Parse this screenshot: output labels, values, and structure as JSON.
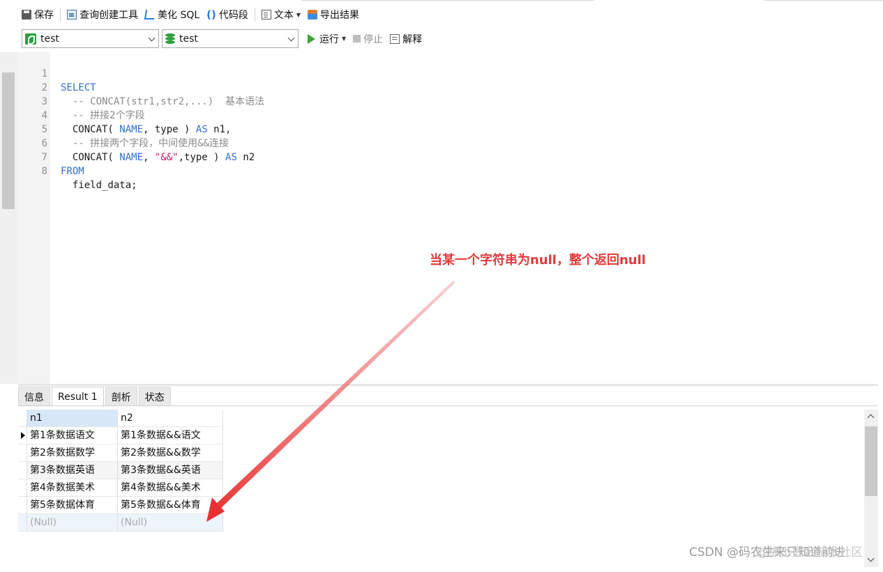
{
  "toolbar": {
    "save": "保存",
    "query_builder": "查询创建工具",
    "beautify": "美化 SQL",
    "snippet": "代码段",
    "text": "文本",
    "export": "导出结果"
  },
  "selectors": {
    "connection": "test",
    "database": "test"
  },
  "run_controls": {
    "run": "运行",
    "stop": "停止",
    "explain": "解释"
  },
  "editor": {
    "line_numbers": [
      "1",
      "2",
      "3",
      "4",
      "5",
      "6",
      "7",
      "8"
    ],
    "l1": "SELECT",
    "l2": "  -- CONCAT(str1,str2,...)  基本语法",
    "l3": "  -- 拼接2个字段",
    "l4_a": "  CONCAT( ",
    "l4_b": "NAME",
    "l4_c": ", type ) ",
    "l4_d": "AS",
    "l4_e": " n1,",
    "l5": "  -- 拼接两个字段，中间使用&&连接",
    "l6_a": "  CONCAT( ",
    "l6_b": "NAME",
    "l6_c": ", ",
    "l6_d": "\"&&\"",
    "l6_e": ",type ) ",
    "l6_f": "AS",
    "l6_g": " n2",
    "l7": "FROM",
    "l8": "  field_data;"
  },
  "annotation": "当某一个字符串为null，整个返回null",
  "tabs": [
    "信息",
    "Result 1",
    "剖析",
    "状态"
  ],
  "result": {
    "columns": [
      "n1",
      "n2"
    ],
    "rows": [
      [
        "第1条数据语文",
        "第1条数据&&语文"
      ],
      [
        "第2条数据数学",
        "第2条数据&&数学"
      ],
      [
        "第3条数据英语",
        "第3条数据&&英语"
      ],
      [
        "第4条数据美术",
        "第4条数据&&美术"
      ],
      [
        "第5条数据体育",
        "第5条数据&&体育"
      ],
      [
        "(Null)",
        "(Null)"
      ]
    ]
  },
  "watermark": "CSDN @码农生来只知道前进",
  "watermark_overlay": "@稀土掘金技术社区",
  "colors": {
    "keyword": "#2f6fd1",
    "comment": "#8a8a8a",
    "string": "#c41a6a",
    "annotation": "#e23a3a",
    "run_green": "#3aa635"
  }
}
